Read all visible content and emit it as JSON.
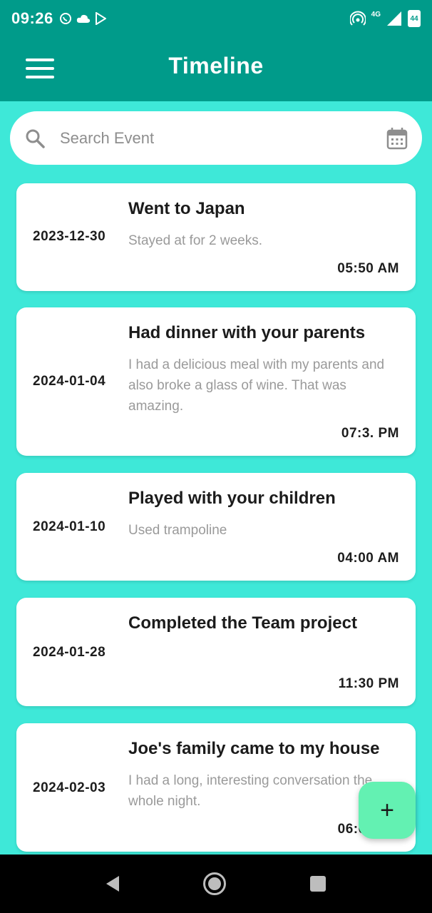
{
  "status_bar": {
    "time": "09:26",
    "network": "4G",
    "battery": "44"
  },
  "app_bar": {
    "title": "Timeline"
  },
  "search": {
    "placeholder": "Search Event"
  },
  "events": [
    {
      "date": "2023-12-30",
      "title": "Went to Japan",
      "description": "Stayed at for 2 weeks.",
      "time": "05:50 AM"
    },
    {
      "date": "2024-01-04",
      "title": "Had dinner with your parents",
      "description": "I had a delicious meal with my parents and also broke a glass of wine. That was amazing.",
      "time": "07:3. PM"
    },
    {
      "date": "2024-01-10",
      "title": "Played with your children",
      "description": "Used trampoline",
      "time": "04:00 AM"
    },
    {
      "date": "2024-01-28",
      "title": "Completed the Team project",
      "description": "",
      "time": "11:30 PM"
    },
    {
      "date": "2024-02-03",
      "title": "Joe's family came to my house",
      "description": "I had a long, interesting conversation the whole night.",
      "time": "06:00 PM"
    }
  ],
  "fab": {
    "label": "+"
  },
  "colors": {
    "header": "#009b8a",
    "background": "#3ee8d8",
    "fab": "#63f1b2"
  }
}
